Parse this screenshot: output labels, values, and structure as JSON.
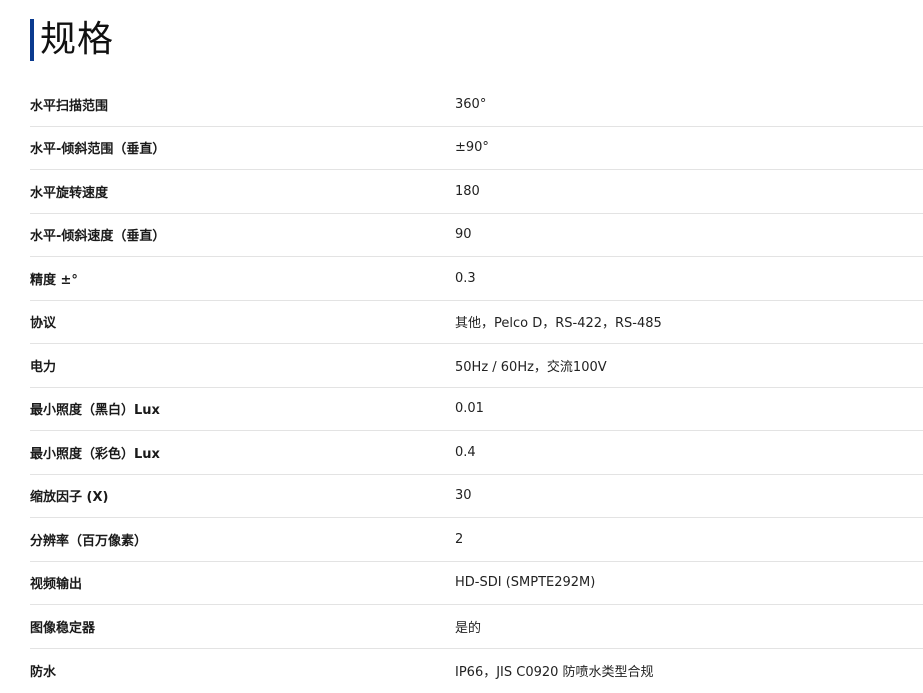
{
  "section": {
    "title": "规格"
  },
  "specs": [
    {
      "label": "水平扫描范围",
      "value": "360°"
    },
    {
      "label": "水平-倾斜范围（垂直）",
      "value": "±90°"
    },
    {
      "label": "水平旋转速度",
      "value": "180"
    },
    {
      "label": "水平-倾斜速度（垂直）",
      "value": "90"
    },
    {
      "label": "精度 ±°",
      "value": "0.3"
    },
    {
      "label": "协议",
      "value": "其他，Pelco D，RS-422，RS-485"
    },
    {
      "label": "电力",
      "value": "50Hz / 60Hz，交流100V"
    },
    {
      "label": "最小照度（黑白）Lux",
      "value": "0.01"
    },
    {
      "label": "最小照度（彩色）Lux",
      "value": "0.4"
    },
    {
      "label": "缩放因子 (X)",
      "value": "30"
    },
    {
      "label": "分辨率（百万像素）",
      "value": "2"
    },
    {
      "label": "视频输出",
      "value": "HD-SDI (SMPTE292M)"
    },
    {
      "label": "图像稳定器",
      "value": "是的"
    },
    {
      "label": "防水",
      "value": "IP66，JIS C0920 防喷水类型合规"
    }
  ],
  "colors": {
    "accent_bar": "#0a3a8f",
    "divider": "#e3e3e3"
  }
}
